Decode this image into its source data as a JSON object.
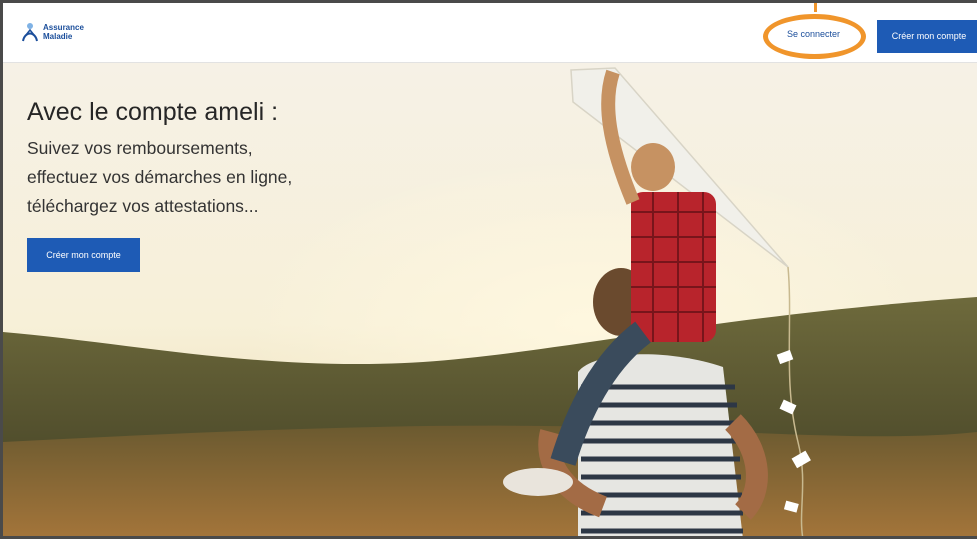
{
  "header": {
    "logo_line1": "Assurance",
    "logo_line2": "Maladie",
    "connect_label": "Se connecter",
    "create_account_label": "Créer mon compte"
  },
  "hero": {
    "title": "Avec le compte ameli :",
    "subtitle_lines": [
      "Suivez vos remboursements,",
      "effectuez vos démarches en ligne,",
      "téléchargez vos attestations..."
    ],
    "cta_label": "Créer mon compte"
  },
  "colors": {
    "brand_blue": "#1e5bb5",
    "highlight_orange": "#f0952b"
  }
}
